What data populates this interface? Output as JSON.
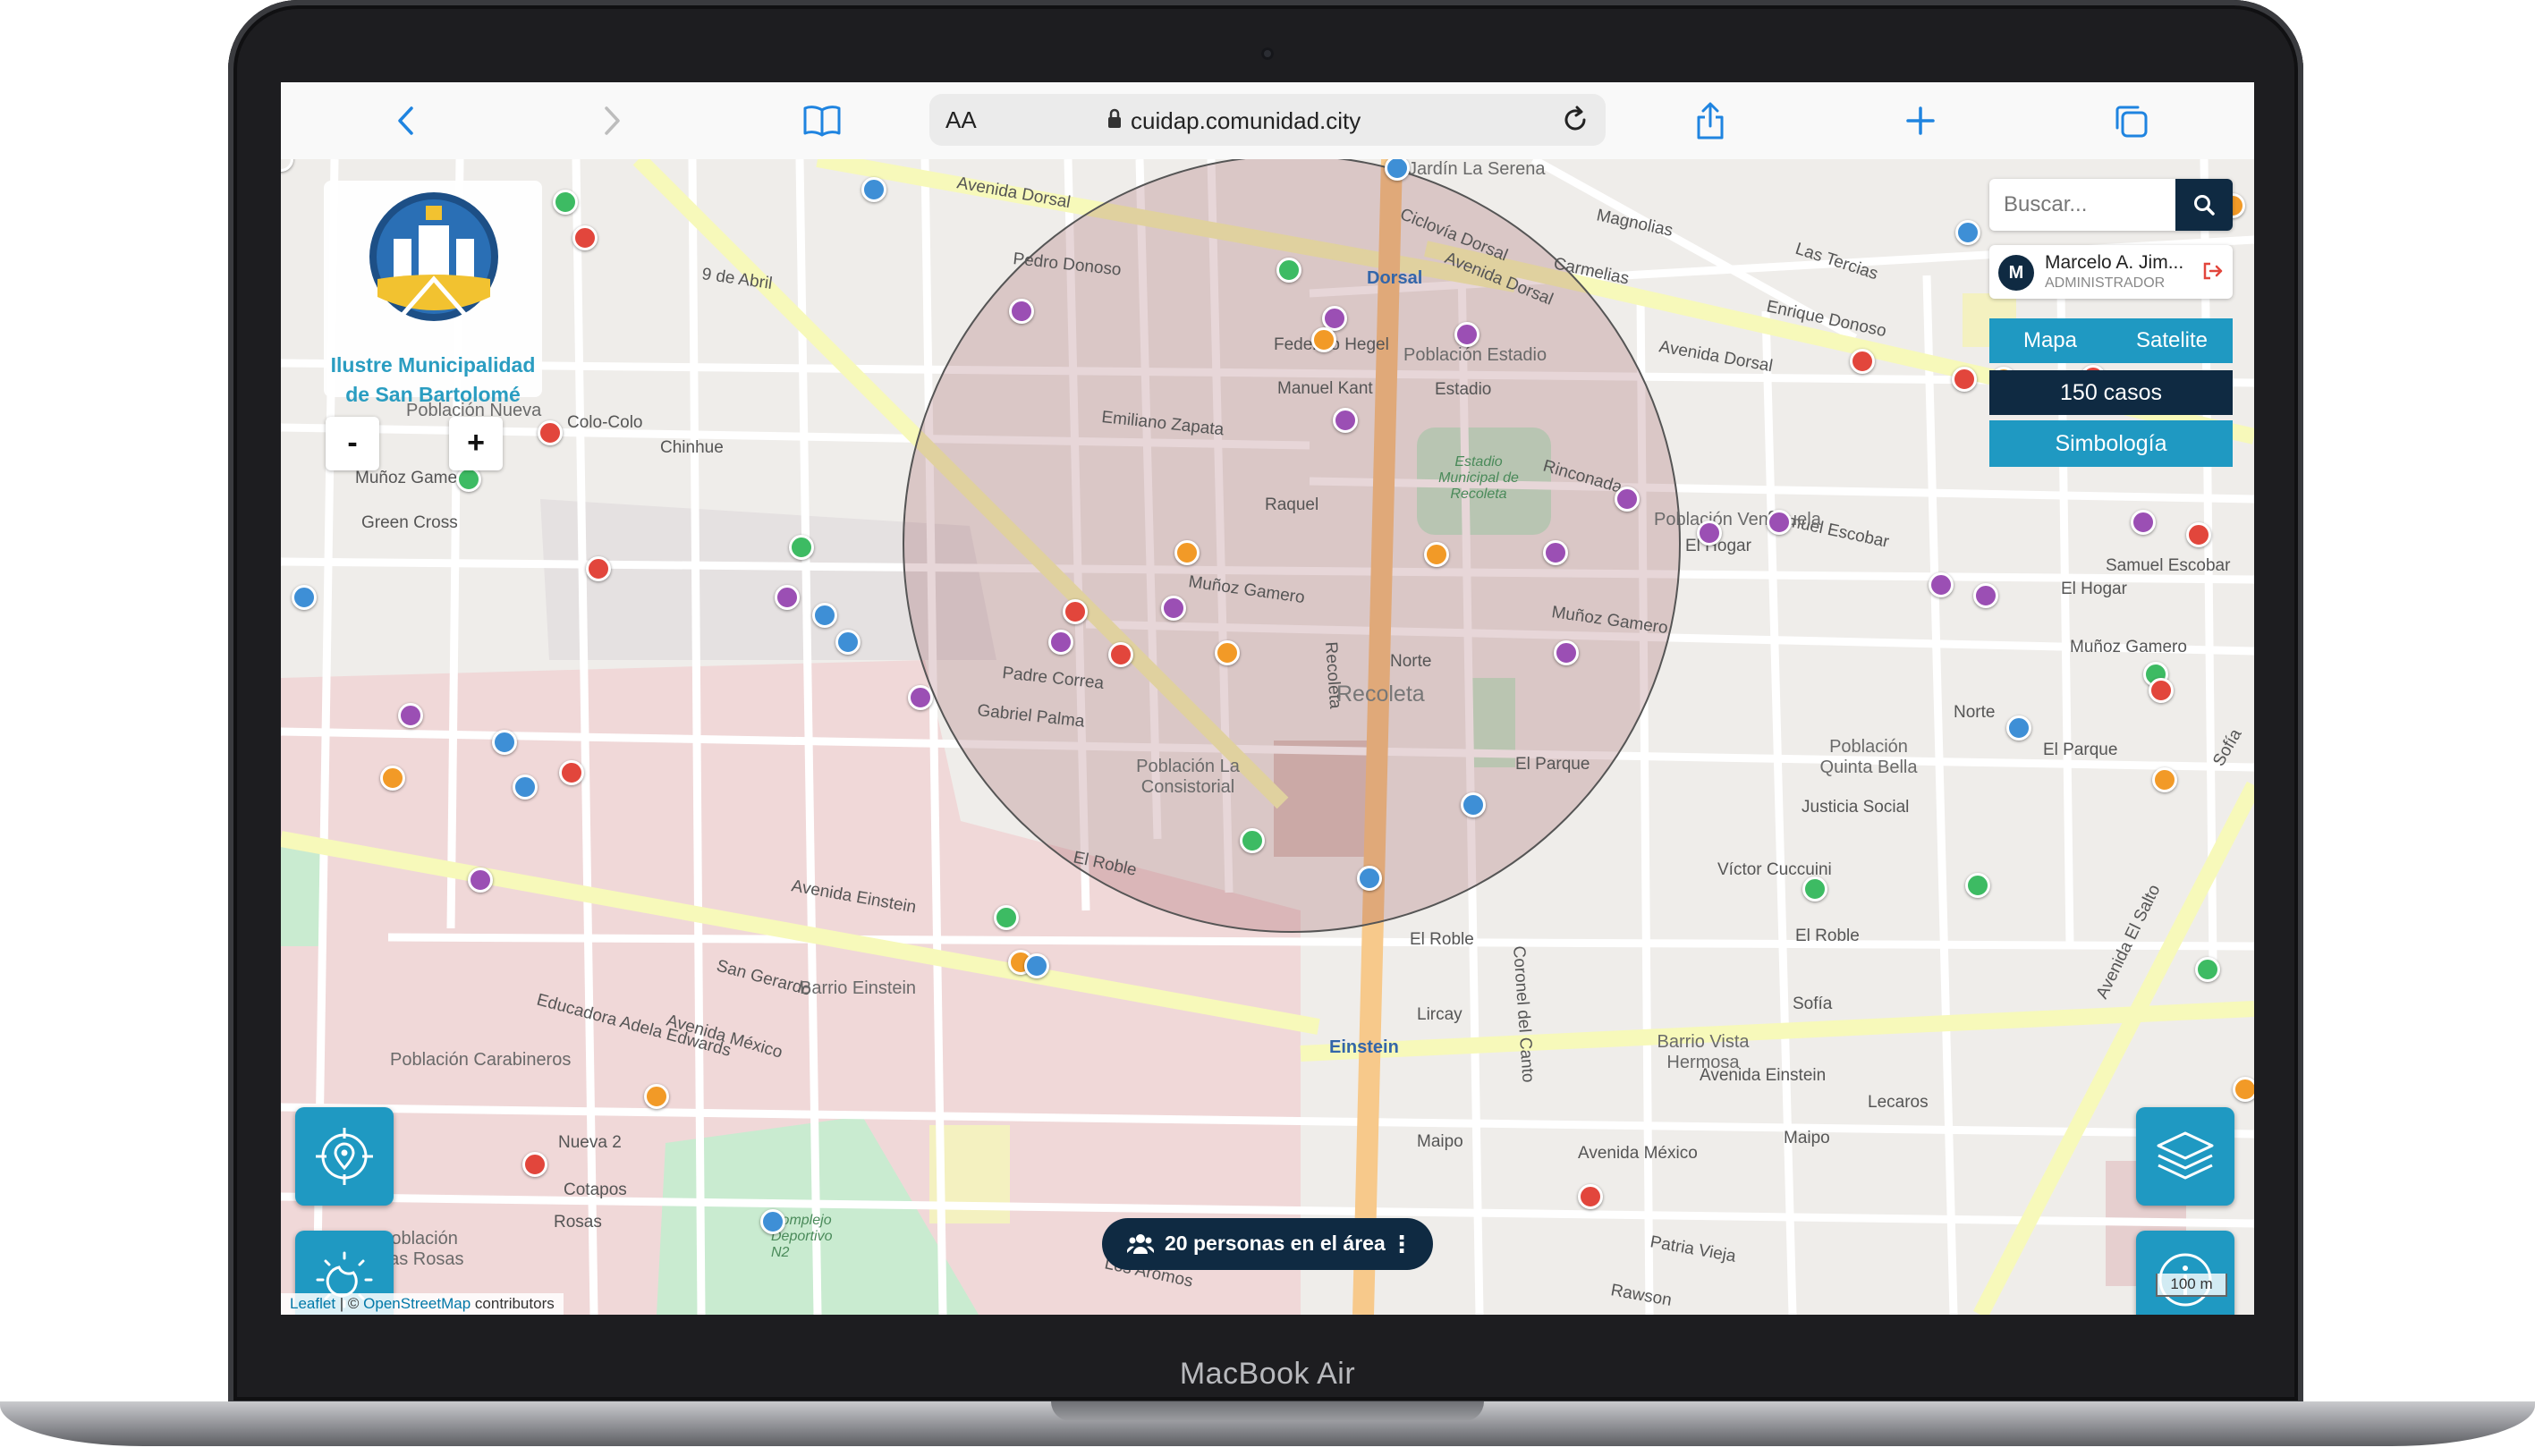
{
  "device": {
    "label": "MacBook Air"
  },
  "browser": {
    "text_size_label": "AA",
    "url": "cuidap.comunidad.city",
    "icons": [
      "back-icon",
      "forward-icon",
      "bookmarks-icon",
      "lock-icon",
      "reload-icon",
      "share-icon",
      "new-tab-icon",
      "tabs-icon"
    ]
  },
  "app": {
    "municipality_line1": "Ilustre Municipalidad",
    "municipality_line2": "de San Bartolomé",
    "zoom_out": "-",
    "zoom_in": "+",
    "search_placeholder": "Buscar...",
    "user": {
      "initial": "M",
      "name": "Marcelo A. Jim...",
      "role": "ADMINISTRADOR"
    },
    "view_modes": [
      "Mapa",
      "Satelite"
    ],
    "cases_count": "150 casos",
    "legend_label": "Simbología",
    "people_in_area": "20 personas en el área",
    "people_more": "⋮",
    "attribution_leaflet": "Leaflet",
    "attribution_sep": " | © ",
    "attribution_osm": "OpenStreetMap",
    "attribution_tail": " contributors",
    "scale_label": "100 m"
  },
  "map": {
    "colors": {
      "red": "#e2463c",
      "green": "#3dbb63",
      "blue": "#3e8fd6",
      "purple": "#9b4fb4",
      "orange": "#f29a27",
      "accent": "#1f99c2",
      "navy": "#0f2a42"
    },
    "place_labels": [
      "Recoleta",
      "Población Estadio",
      "Población Venezuela",
      "Población La Consistorial",
      "Barrio Einstein",
      "Barrio Vista Hermosa",
      "Población Quinta Bella",
      "Población Nueva",
      "Jardín La Serena",
      "Población Carabineros",
      "Población Las Rosas",
      "Dorsal",
      "Einstein",
      "Estadio Municipal de Recoleta",
      "Complejo Deportivo N2"
    ],
    "street_labels": [
      "Avenida Dorsal",
      "Avenida Einstein",
      "Avenida México",
      "Lircay",
      "El Roble",
      "Muñoz Gamero",
      "Emiliano Zapata",
      "Manuel Kant",
      "Raquel",
      "Norte",
      "El Parque",
      "Justicia Social",
      "Víctor Cuccuini",
      "Maipo",
      "Lecaros",
      "Padre Correa",
      "Gabriel Palma",
      "Educadora Adela Edwards",
      "San Gerardo",
      "Avenida El Salto",
      "Colo-Colo",
      "Green Cross",
      "El Hogar",
      "Samuel Escobar",
      "Rinconada",
      "Magnolias",
      "Carmelias",
      "Las Tercias",
      "Enrique Donoso",
      "Pedro Donoso",
      "Chinhue",
      "Rawson",
      "Patria Vieja",
      "Los Aromos",
      "Estadio",
      "Federico Hegel",
      "Coronel del Canto",
      "Recoleta",
      "Ciclovía Dorsal",
      "9 de Abril",
      "Avenida Einstein ",
      "Cotapos",
      "Nueva 2",
      "Rosas",
      "Sofía",
      "Lircay ",
      "El Parque "
    ]
  }
}
